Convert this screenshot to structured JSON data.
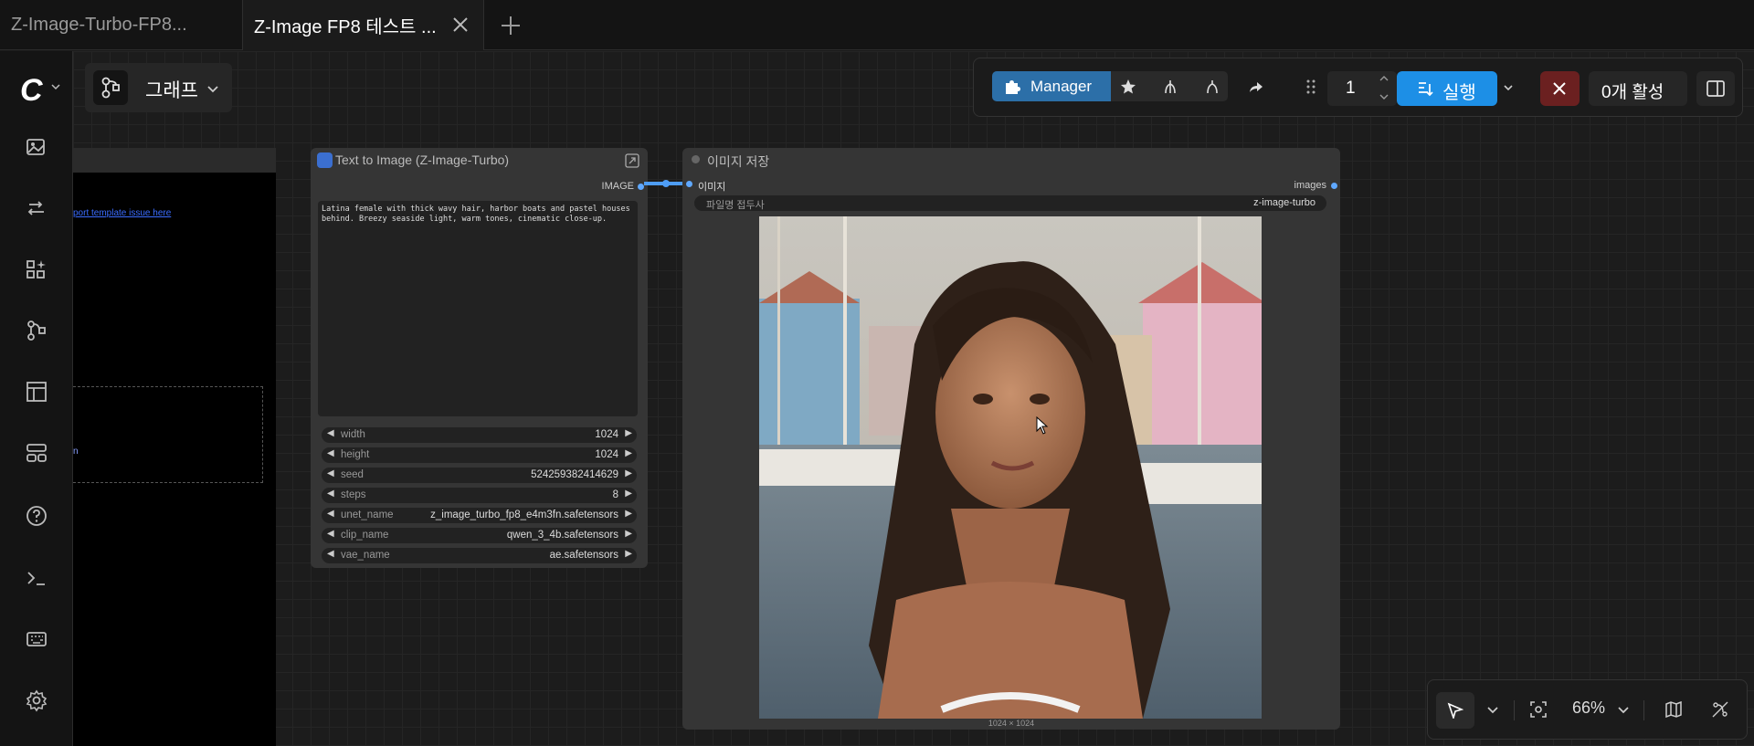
{
  "tabs": [
    {
      "label": "Z-Image-Turbo-FP8..."
    },
    {
      "label": "Z-Image FP8 테스트 ..."
    }
  ],
  "graph_menu": {
    "label": "그래프"
  },
  "left_node": {
    "link_text": "port template issue here"
  },
  "t2i_node": {
    "title": "Text to Image (Z-Image-Turbo)",
    "output_label": "IMAGE",
    "prompt": "Latina female with thick wavy hair, harbor boats and pastel houses behind. Breezy seaside light, warm tones, cinematic close-up.",
    "widgets": [
      {
        "name": "width",
        "value": "1024"
      },
      {
        "name": "height",
        "value": "1024"
      },
      {
        "name": "seed",
        "value": "524259382414629"
      },
      {
        "name": "steps",
        "value": "8"
      },
      {
        "name": "unet_name",
        "value": "z_image_turbo_fp8_e4m3fn.safetensors"
      },
      {
        "name": "clip_name",
        "value": "qwen_3_4b.safetensors"
      },
      {
        "name": "vae_name",
        "value": "ae.safetensors"
      }
    ]
  },
  "save_node": {
    "title": "이미지 저장",
    "input_label": "이미지",
    "output_label": "images",
    "prefix_name": "파일명 접두사",
    "prefix_value": "z-image-turbo",
    "dimensions": "1024 × 1024"
  },
  "toolbar": {
    "manager_label": "Manager",
    "batch_count": "1",
    "run_label": "실행",
    "active_label": "0개 활성"
  },
  "bottom_toolbar": {
    "zoom": "66%"
  },
  "colors": {
    "accent": "#1d8fe6",
    "manager": "#2c6fa8",
    "cancel": "#6b2020",
    "link": "#4e9df5"
  }
}
